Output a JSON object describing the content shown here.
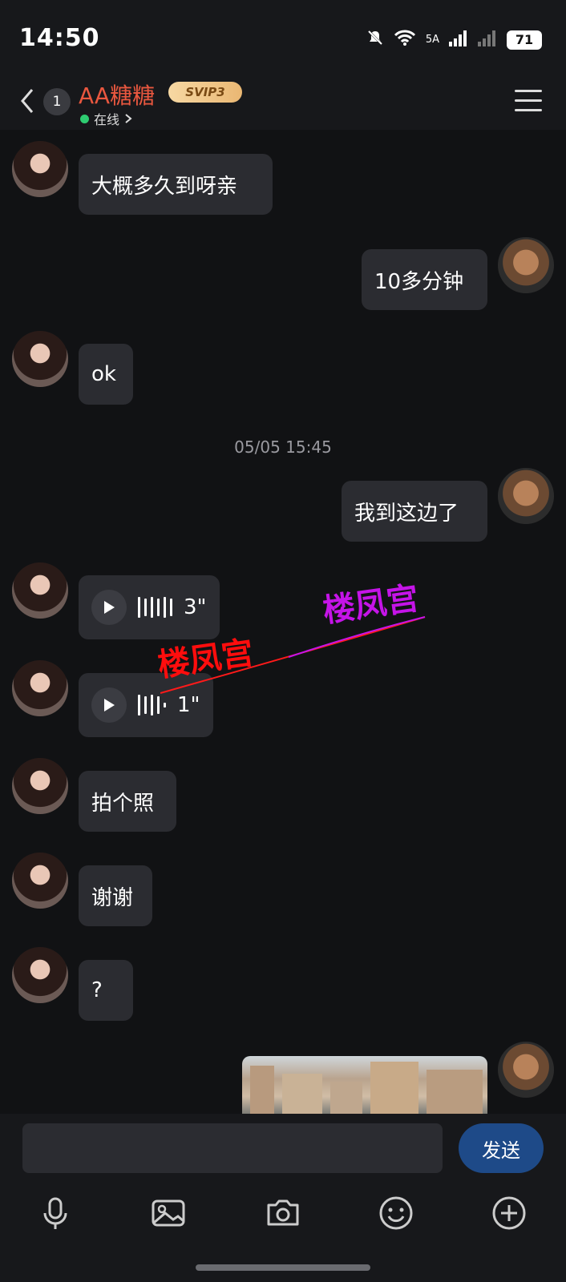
{
  "status_bar": {
    "time": "14:50",
    "network": "5A",
    "battery": "71"
  },
  "header": {
    "unread_count": "1",
    "contact_name": "AA糖糖",
    "vip_badge": "SVIP3",
    "presence": "在线"
  },
  "messages": [
    {
      "side": "left",
      "type": "text",
      "text": "大概多久到呀亲"
    },
    {
      "side": "right",
      "type": "text",
      "text": "10多分钟"
    },
    {
      "side": "left",
      "type": "text",
      "text": "ok"
    },
    {
      "side": "center",
      "type": "timestamp",
      "text": "05/05 15:45"
    },
    {
      "side": "right",
      "type": "text",
      "text": "我到这边了"
    },
    {
      "side": "left",
      "type": "voice",
      "duration": "3\""
    },
    {
      "side": "left",
      "type": "voice",
      "duration": "1\""
    },
    {
      "side": "left",
      "type": "text",
      "text": "拍个照"
    },
    {
      "side": "left",
      "type": "text",
      "text": "谢谢"
    },
    {
      "side": "left",
      "type": "text",
      "text": "?"
    },
    {
      "side": "right",
      "type": "image"
    }
  ],
  "watermark": {
    "text": "楼凤宫"
  },
  "input": {
    "send_label": "发送",
    "placeholder": ""
  },
  "toolbar": {
    "icons": [
      "microphone-icon",
      "image-icon",
      "camera-icon",
      "emoji-icon",
      "plus-icon"
    ]
  },
  "colors": {
    "background": "#111214",
    "bubble": "#2b2c31",
    "name": "#e9573f",
    "send_button": "#1e4a88",
    "online": "#2ecc71"
  }
}
